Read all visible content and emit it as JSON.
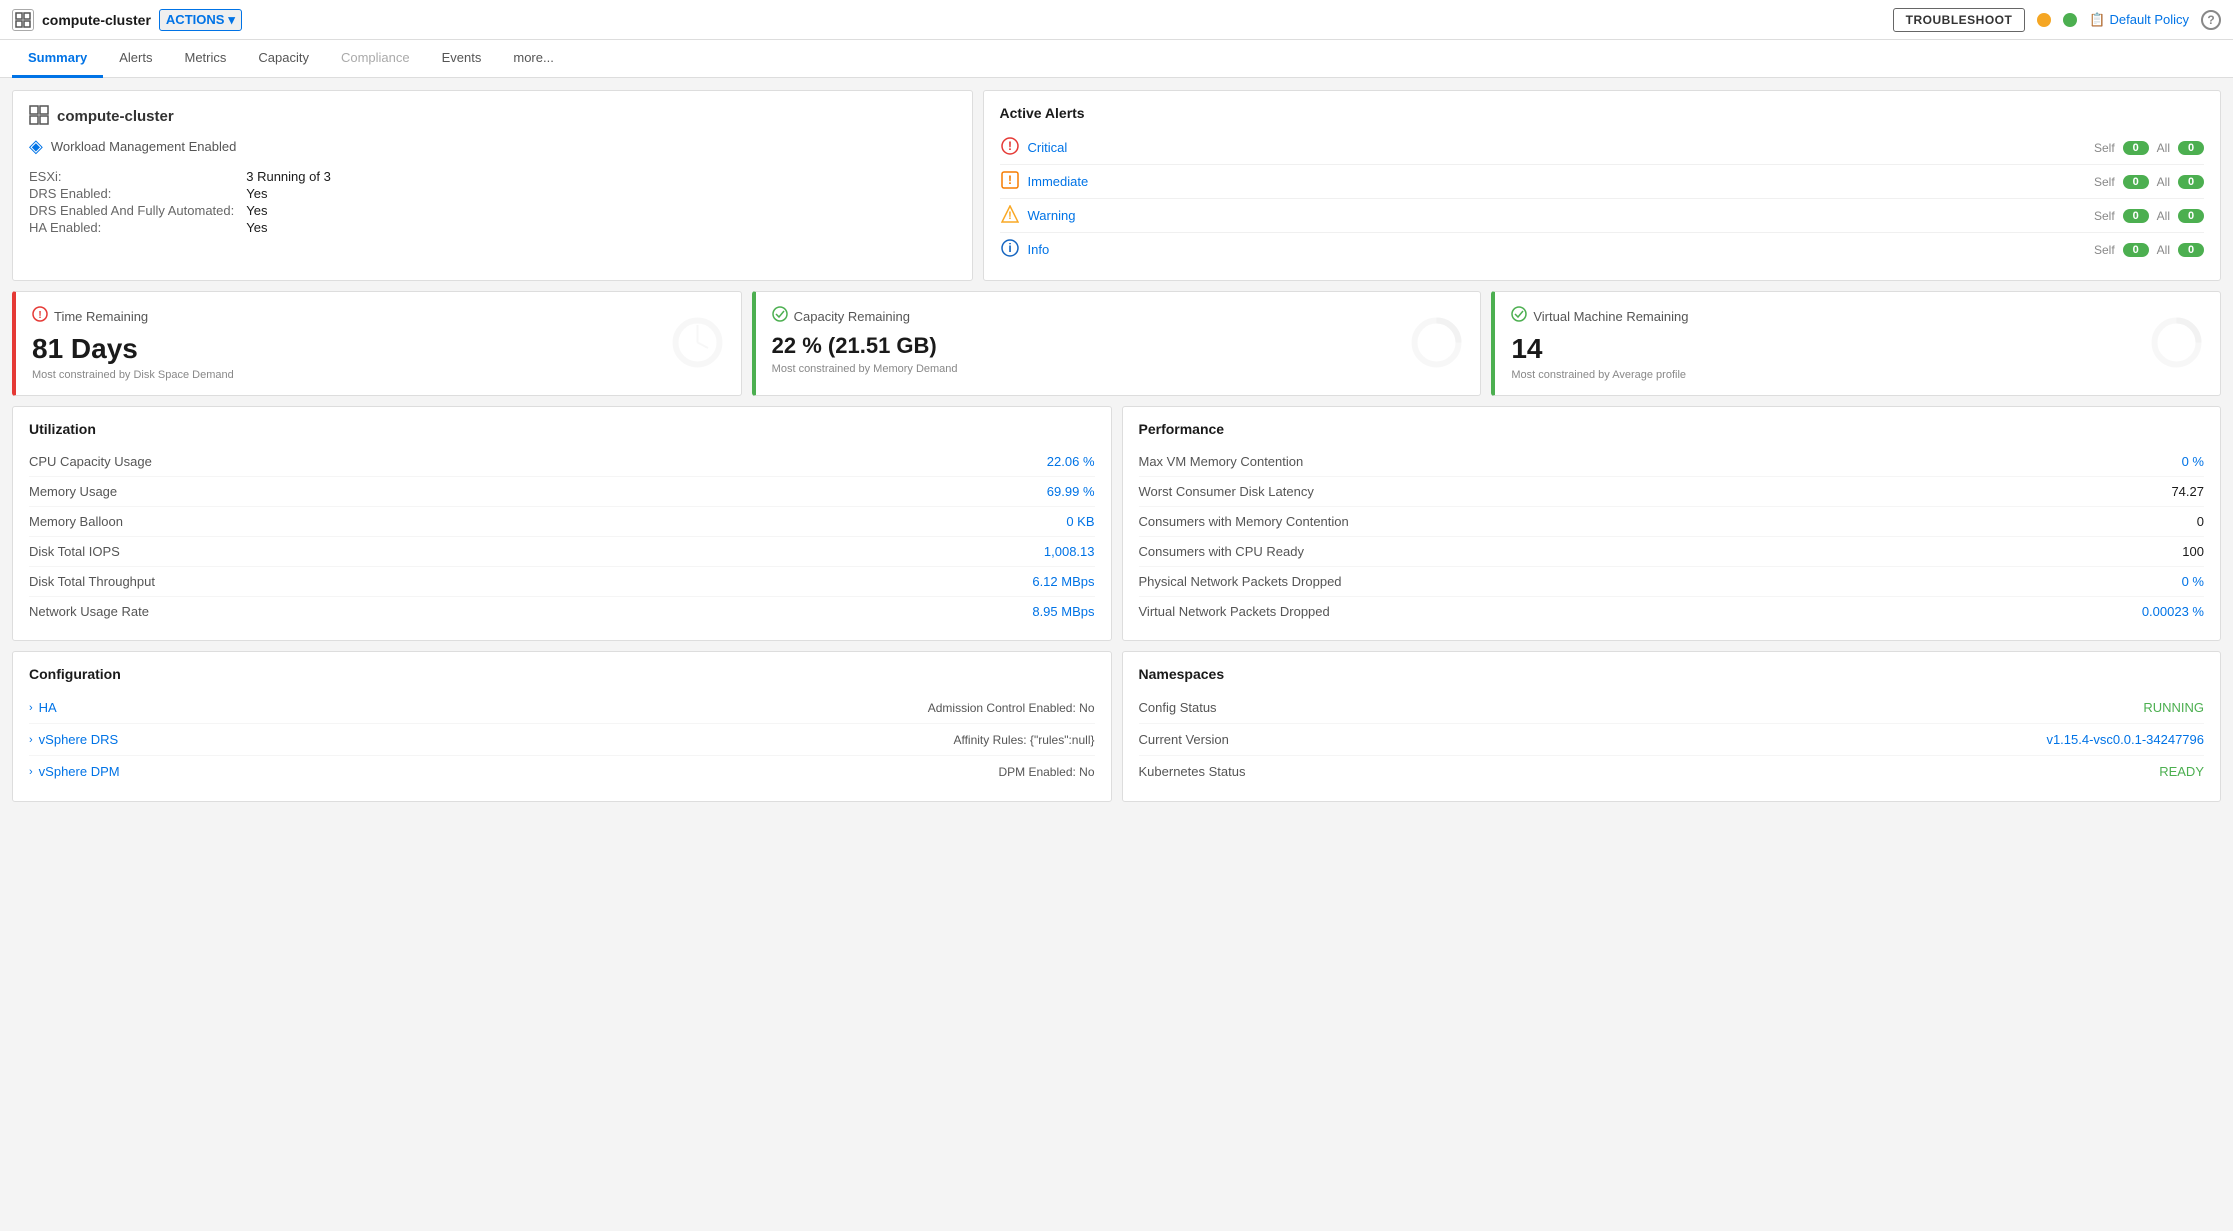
{
  "topbar": {
    "cluster_icon": "⊞",
    "cluster_name": "compute-cluster",
    "actions_label": "ACTIONS",
    "actions_chevron": "▾",
    "troubleshoot_label": "TROUBLESHOOT",
    "policy_icon": "📋",
    "policy_label": "Default Policy",
    "help_label": "?",
    "status_yellow": "yellow",
    "status_green": "green"
  },
  "tabs": [
    {
      "label": "Summary",
      "active": true,
      "disabled": false
    },
    {
      "label": "Alerts",
      "active": false,
      "disabled": false
    },
    {
      "label": "Metrics",
      "active": false,
      "disabled": false
    },
    {
      "label": "Capacity",
      "active": false,
      "disabled": false
    },
    {
      "label": "Compliance",
      "active": false,
      "disabled": true
    },
    {
      "label": "Events",
      "active": false,
      "disabled": false
    },
    {
      "label": "more...",
      "active": false,
      "disabled": false
    }
  ],
  "cluster_info": {
    "name": "compute-cluster",
    "workload": "Workload Management Enabled",
    "esxi_label": "ESXi:",
    "esxi_value": "3 Running of 3",
    "drs_label": "DRS Enabled:",
    "drs_value": "Yes",
    "drs_auto_label": "DRS Enabled And Fully Automated:",
    "drs_auto_value": "Yes",
    "ha_label": "HA Enabled:",
    "ha_value": "Yes"
  },
  "active_alerts": {
    "title": "Active Alerts",
    "rows": [
      {
        "name": "Critical",
        "icon": "critical",
        "self_count": "0",
        "all_count": "0"
      },
      {
        "name": "Immediate",
        "icon": "immediate",
        "self_count": "0",
        "all_count": "0"
      },
      {
        "name": "Warning",
        "icon": "warning",
        "self_count": "0",
        "all_count": "0"
      },
      {
        "name": "Info",
        "icon": "info",
        "self_count": "0",
        "all_count": "0"
      }
    ],
    "self_label": "Self",
    "all_label": "All"
  },
  "metrics": [
    {
      "title": "Time Remaining",
      "value": "81 Days",
      "sub": "Most constrained by Disk Space Demand",
      "border": "red",
      "icon": "red"
    },
    {
      "title": "Capacity Remaining",
      "value": "22 % (21.51 GB)",
      "sub": "Most constrained by Memory Demand",
      "border": "green",
      "icon": "green"
    },
    {
      "title": "Virtual Machine Remaining",
      "value": "14",
      "sub": "Most constrained by Average profile",
      "border": "green",
      "icon": "green"
    }
  ],
  "utilization": {
    "title": "Utilization",
    "rows": [
      {
        "label": "CPU Capacity Usage",
        "value": "22.06 %",
        "link": true
      },
      {
        "label": "Memory Usage",
        "value": "69.99 %",
        "link": true
      },
      {
        "label": "Memory Balloon",
        "value": "0 KB",
        "link": true
      },
      {
        "label": "Disk Total IOPS",
        "value": "1,008.13",
        "link": true
      },
      {
        "label": "Disk Total Throughput",
        "value": "6.12 MBps",
        "link": true
      },
      {
        "label": "Network Usage Rate",
        "value": "8.95 MBps",
        "link": true
      }
    ]
  },
  "performance": {
    "title": "Performance",
    "rows": [
      {
        "label": "Max VM Memory Contention",
        "value": "0 %",
        "link": true
      },
      {
        "label": "Worst Consumer Disk Latency",
        "value": "74.27",
        "link": false
      },
      {
        "label": "Consumers with Memory Contention",
        "value": "0",
        "link": false
      },
      {
        "label": "Consumers with CPU Ready",
        "value": "100",
        "link": false
      },
      {
        "label": "Physical Network Packets Dropped",
        "value": "0 %",
        "link": true
      },
      {
        "label": "Virtual Network Packets Dropped",
        "value": "0.00023 %",
        "link": true
      }
    ]
  },
  "configuration": {
    "title": "Configuration",
    "rows": [
      {
        "name": "HA",
        "value": "Admission Control Enabled: No"
      },
      {
        "name": "vSphere DRS",
        "value": "Affinity Rules: {\"rules\":null}"
      },
      {
        "name": "vSphere DPM",
        "value": "DPM Enabled: No"
      }
    ]
  },
  "namespaces": {
    "title": "Namespaces",
    "rows": [
      {
        "label": "Config Status",
        "value": "RUNNING",
        "green": true
      },
      {
        "label": "Current Version",
        "value": "v1.15.4-vsc0.0.1-34247796",
        "green": false
      },
      {
        "label": "Kubernetes Status",
        "value": "READY",
        "green": true
      }
    ]
  }
}
